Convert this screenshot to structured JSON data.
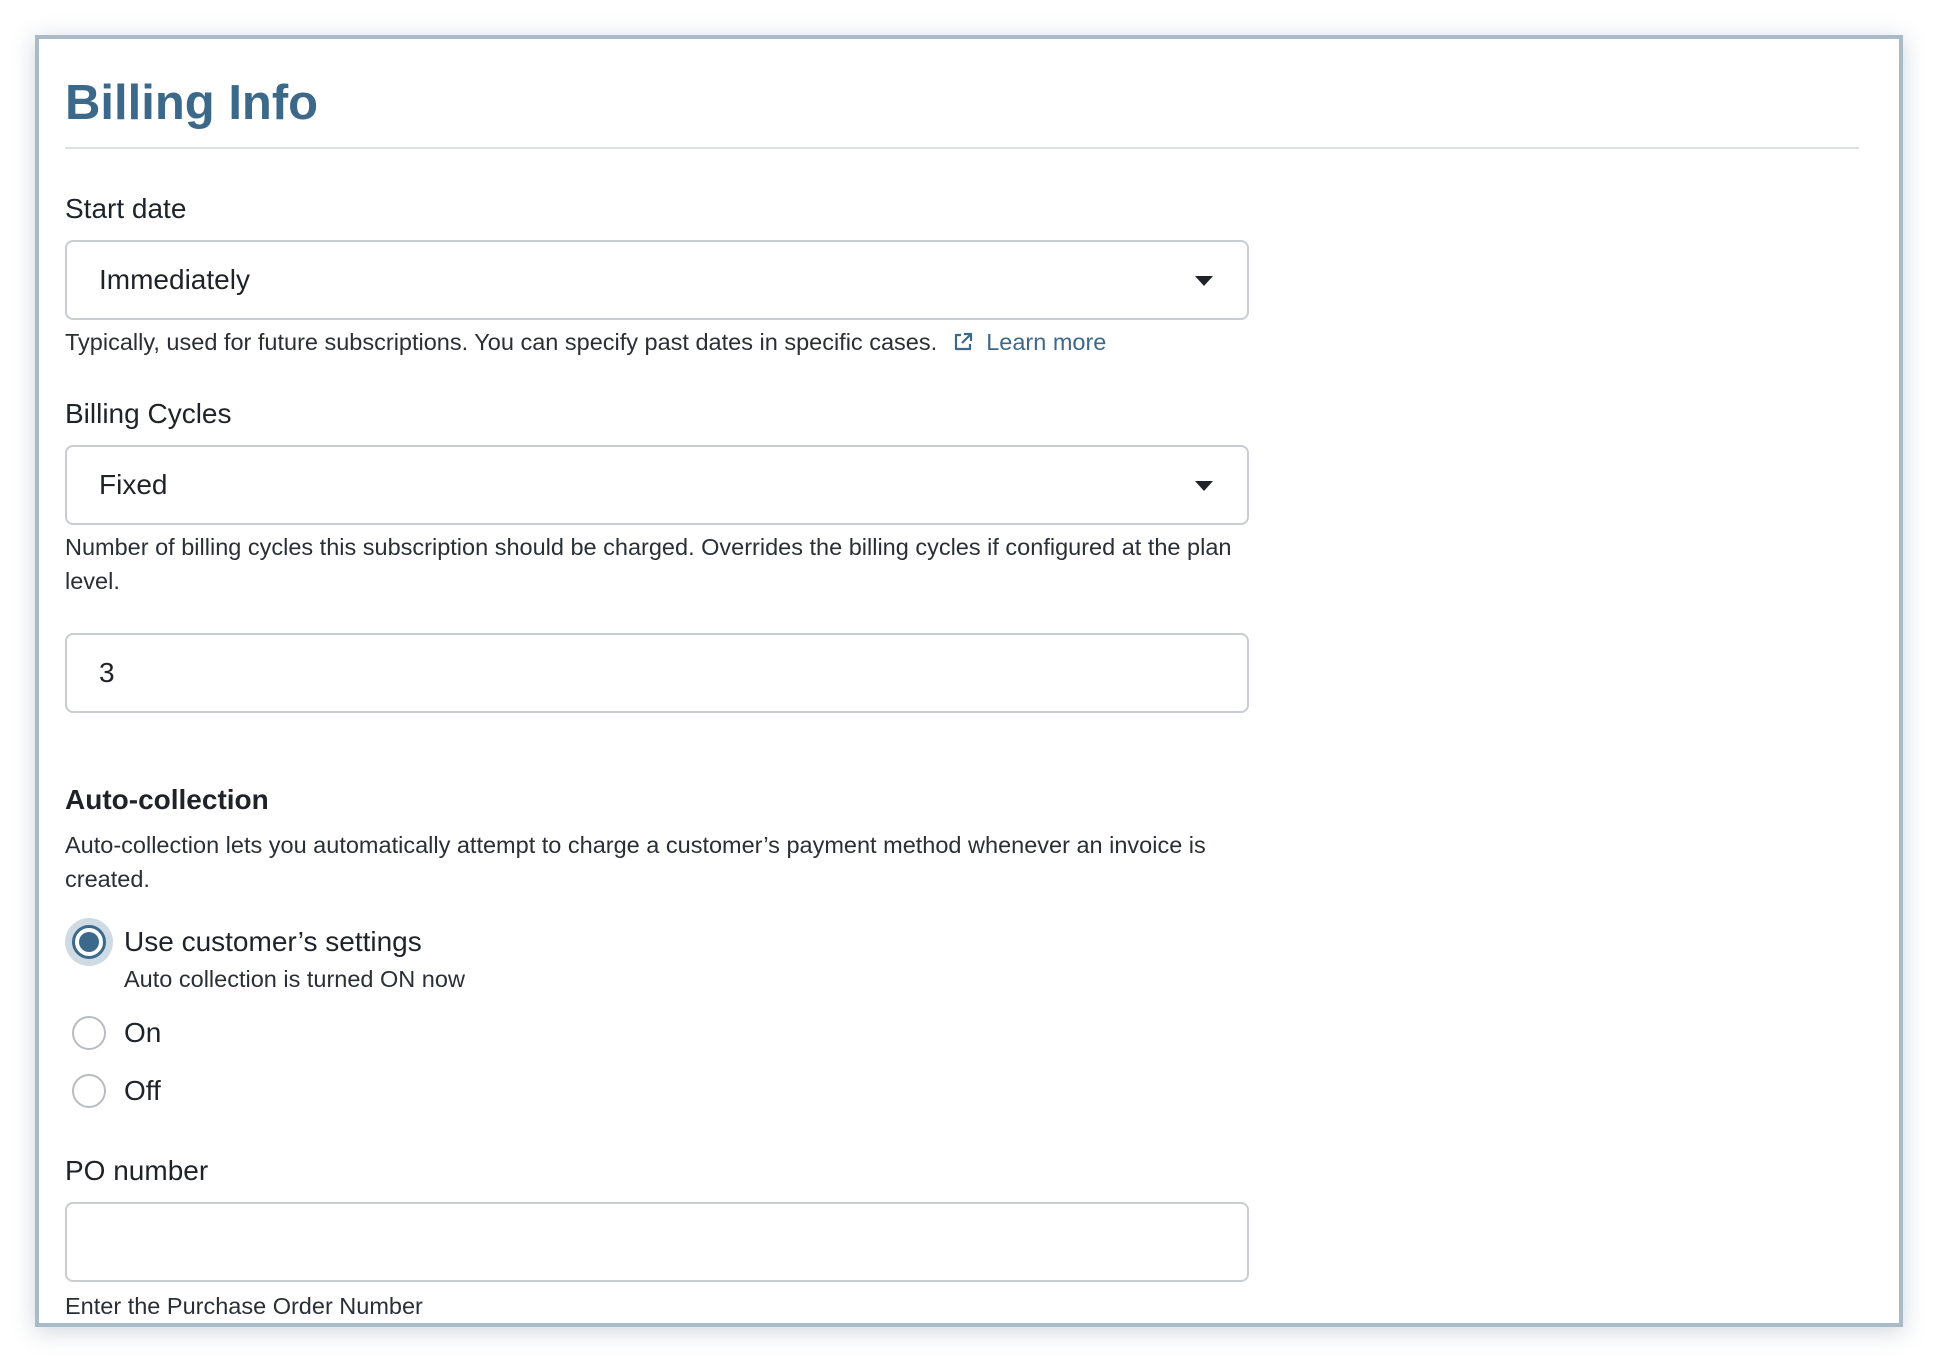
{
  "panel": {
    "title": "Billing Info"
  },
  "start_date": {
    "label": "Start date",
    "selected": "Immediately",
    "help": "Typically, used for future subscriptions. You can specify past dates in specific cases.",
    "link_label": "Learn more"
  },
  "billing_cycles": {
    "label": "Billing Cycles",
    "selected": "Fixed",
    "help": "Number of billing cycles this subscription should be charged. Overrides the billing cycles if configured at the plan level.",
    "count_value": "3"
  },
  "auto_collection": {
    "label": "Auto-collection",
    "help": "Auto-collection lets you automatically attempt to charge a customer’s payment method whenever an invoice is created.",
    "options": [
      {
        "label": "Use customer’s settings",
        "sub": "Auto collection is turned ON now",
        "checked": true
      },
      {
        "label": "On",
        "checked": false
      },
      {
        "label": "Off",
        "checked": false
      }
    ]
  },
  "po_number": {
    "label": "PO number",
    "value": "",
    "help": "Enter the Purchase Order Number"
  },
  "colors": {
    "accent": "#3c6989",
    "border": "#c9ccd1",
    "frame": "#a9bac8"
  },
  "icons": {
    "select_caret": "caret-down-icon",
    "external_link": "external-link-icon"
  }
}
